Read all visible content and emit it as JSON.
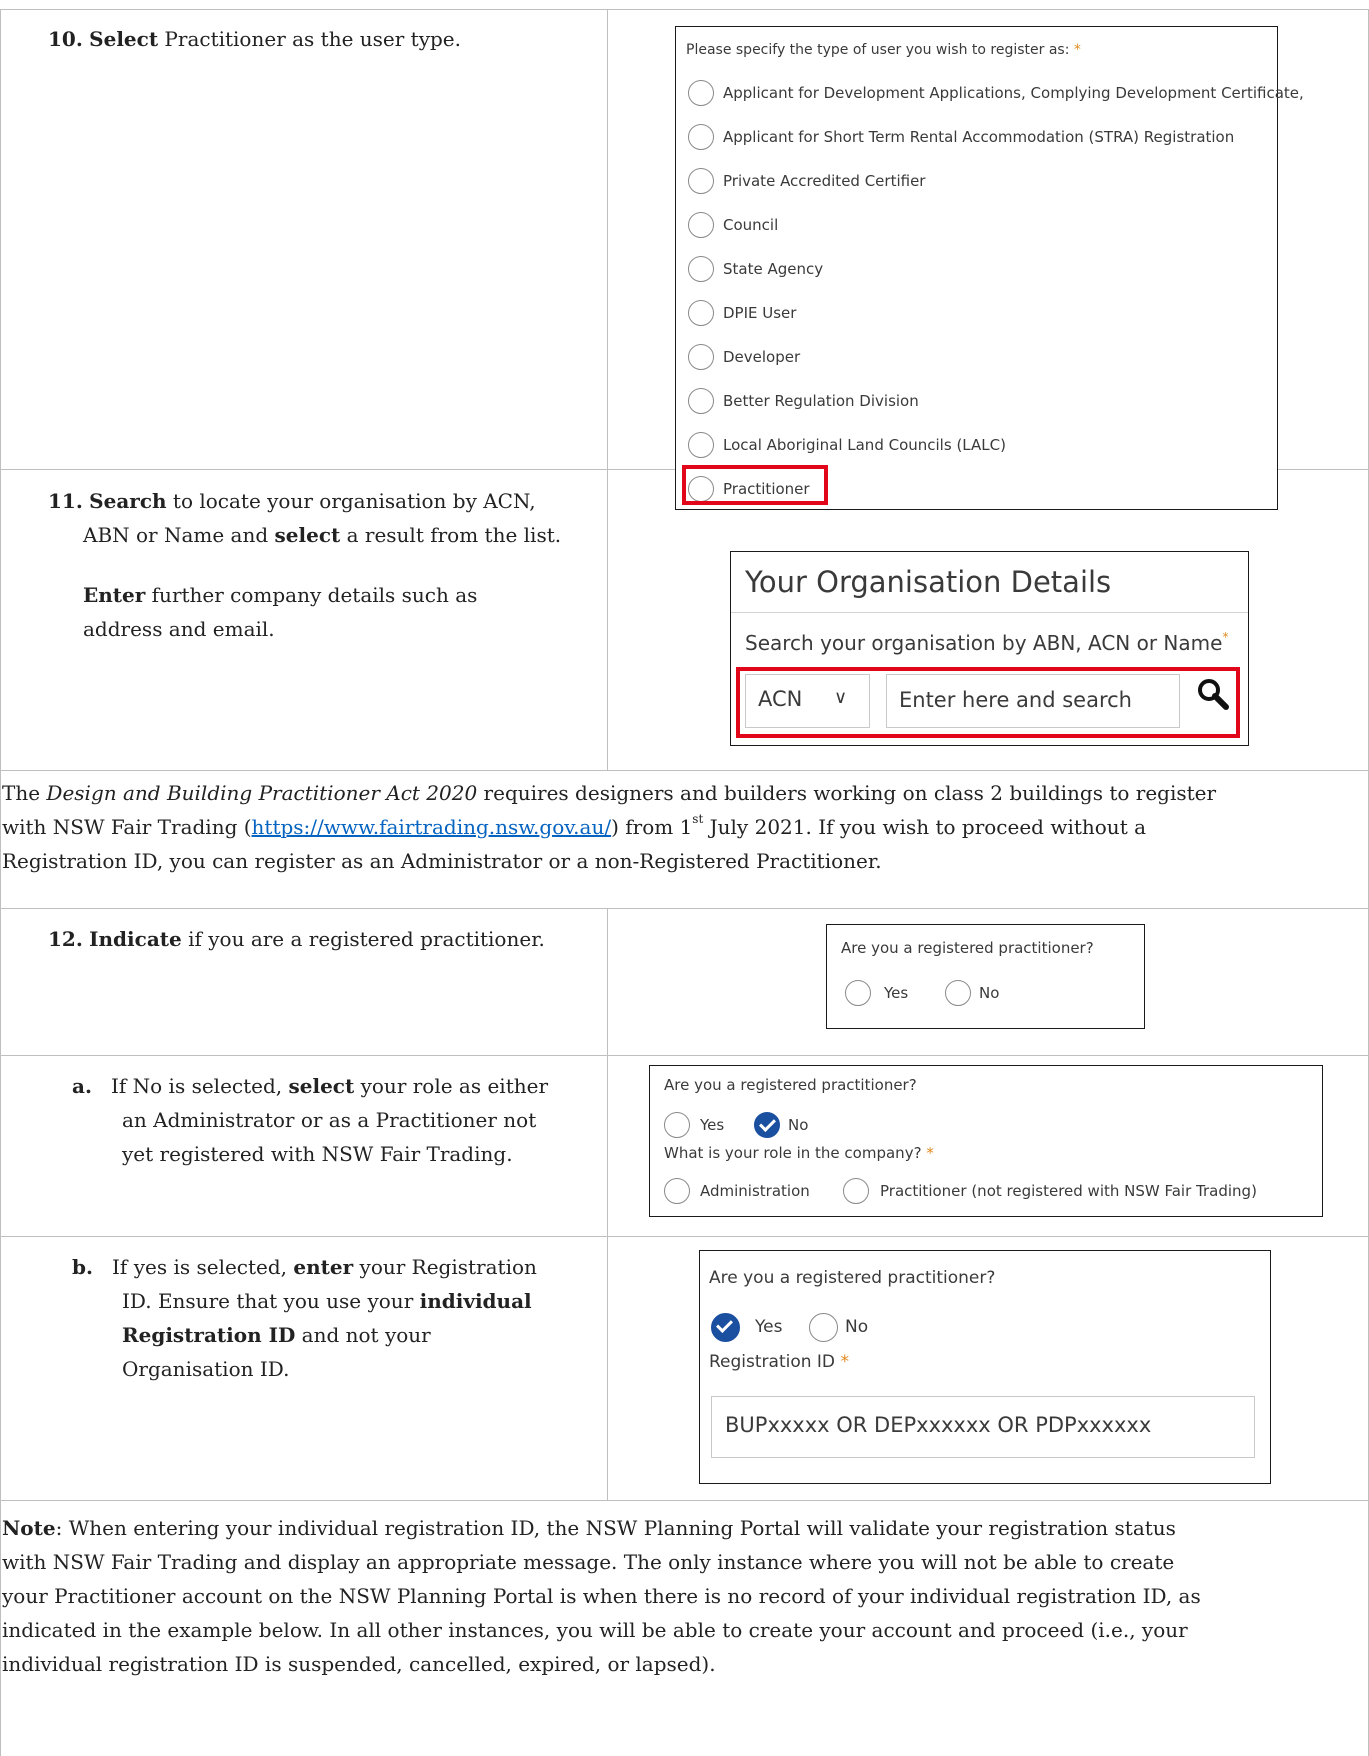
{
  "step10": {
    "num": "10.",
    "verb": "Select",
    "rest": " Practitioner as the user type.",
    "question": "Please specify the type of user you wish to register as:",
    "required_mark": "*",
    "options": [
      "Applicant for Development Applications, Complying Development Certificate,",
      "Applicant for Short Term Rental Accommodation (STRA) Registration",
      "Private Accredited Certifier",
      "Council",
      "State Agency",
      "DPIE User",
      "Developer",
      "Better Regulation Division",
      "Local Aboriginal Land Councils (LALC)",
      "Practitioner"
    ]
  },
  "step11": {
    "num": "11.",
    "verb": "Search",
    "rest1": " to locate your organisation by ACN,",
    "rest2": "ABN or Name and ",
    "verb2": "select",
    "rest3": " a result from the list.",
    "enter_verb": "Enter",
    "enter_rest1": " further company details such as",
    "enter_rest2": "address and email.",
    "panel_title": "Your Organisation Details",
    "search_label": "Search your organisation by ABN, ACN or Name",
    "required_mark": "*",
    "select_value": "ACN",
    "search_placeholder": "Enter here and search"
  },
  "act_para": {
    "pre": "The ",
    "act_italic": "Design and Building Practitioner Act 2020",
    "mid": " requires designers and builders working on class 2 buildings to register",
    "line2_pre": "with NSW Fair Trading (",
    "link": "https://www.fairtrading.nsw.gov.au/",
    "line2_mid": ") from 1",
    "sup": "st",
    "line2_post": " July 2021. If you wish to proceed without a",
    "line3": "Registration ID, you can register as an Administrator or a non-Registered Practitioner."
  },
  "step12": {
    "num": "12.",
    "verb": "Indicate",
    "rest": " if you are a registered practitioner.",
    "question": "Are you a registered practitioner?",
    "yes": "Yes",
    "no": "No"
  },
  "step12a": {
    "letter": "a.",
    "l1_pre": "If No is selected, ",
    "l1_verb": "select",
    "l1_post": " your role as either",
    "l2": "an Administrator or as a Practitioner not",
    "l3": "yet registered with NSW Fair Trading.",
    "question": "Are you a registered practitioner?",
    "yes": "Yes",
    "no": "No",
    "role_question": "What is your role in the company?",
    "required_mark": "*",
    "role_admin": "Administration",
    "role_practitioner": "Practitioner (not registered with NSW Fair Trading)"
  },
  "step12b": {
    "letter": "b.",
    "l1_pre": "If yes is selected, ",
    "l1_verb": "enter",
    "l1_post": " your Registration",
    "l2_pre": "ID. Ensure that you use your ",
    "l2_bold": "individual",
    "l3_bold": "Registration ID",
    "l3_post": " and not your",
    "l4": "Organisation ID.",
    "question": "Are you a registered practitioner?",
    "yes": "Yes",
    "no": "No",
    "reg_label": "Registration ID",
    "required_mark": "*",
    "reg_placeholder": "BUPxxxxx OR DEPxxxxxx OR PDPxxxxxx"
  },
  "note": {
    "bold": "Note",
    "l1": ":  When entering your individual registration ID, the NSW Planning Portal will validate your registration status",
    "l2": "with NSW Fair Trading and display an appropriate message. The only instance where you will not be able to create",
    "l3": "your Practitioner account on the NSW Planning Portal is when there is no record of your individual registration ID, as",
    "l4": "indicated in the example below. In all other instances, you will be able to create your account and proceed (i.e., your",
    "l5": "individual registration ID is suspended, cancelled, expired, or lapsed)."
  },
  "colors": {
    "accent_red": "#e2061a",
    "link": "#0563c1",
    "radio_checked": "#1b4fa0",
    "required": "#e08a1e"
  }
}
